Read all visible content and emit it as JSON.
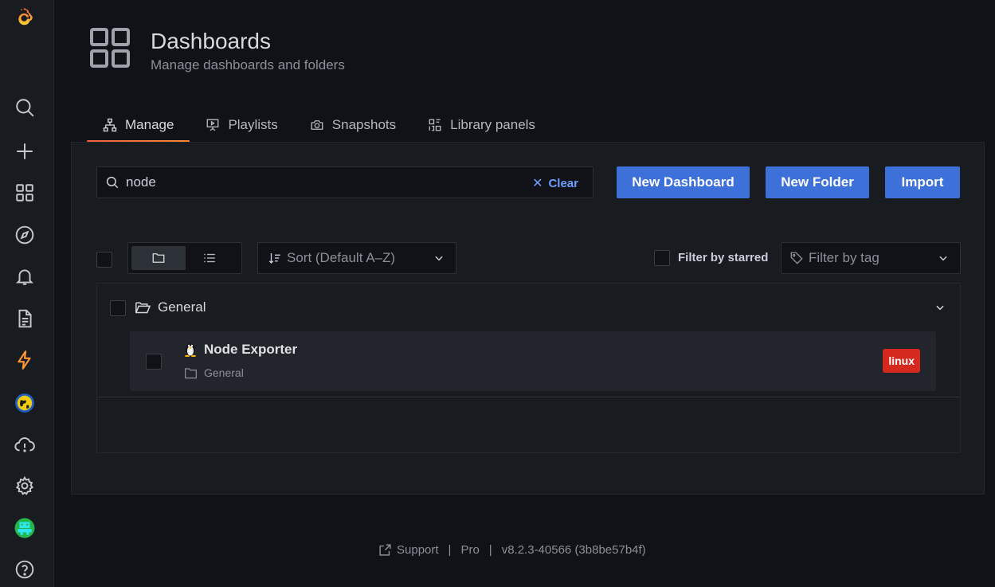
{
  "sidebar": {
    "items": [
      {
        "name": "grafana-logo-icon"
      },
      {
        "name": "search-icon"
      },
      {
        "name": "plus-icon"
      },
      {
        "name": "dashboards-icon"
      },
      {
        "name": "explore-compass-icon"
      },
      {
        "name": "alerting-bell-icon"
      },
      {
        "name": "reports-document-icon"
      },
      {
        "name": "lightning-icon"
      },
      {
        "name": "worldmap-icon"
      },
      {
        "name": "cloud-alert-icon"
      },
      {
        "name": "gear-icon"
      },
      {
        "name": "user-avatar"
      },
      {
        "name": "help-icon"
      }
    ]
  },
  "header": {
    "title": "Dashboards",
    "subtitle": "Manage dashboards and folders"
  },
  "tabs": [
    {
      "label": "Manage",
      "active": true
    },
    {
      "label": "Playlists",
      "active": false
    },
    {
      "label": "Snapshots",
      "active": false
    },
    {
      "label": "Library panels",
      "active": false
    }
  ],
  "search": {
    "value": "node",
    "clear_label": "Clear"
  },
  "buttons": {
    "new_dashboard": "New Dashboard",
    "new_folder": "New Folder",
    "import": "Import"
  },
  "filters": {
    "sort_label": "Sort (Default A–Z)",
    "starred_label": "Filter by starred",
    "tag_placeholder": "Filter by tag"
  },
  "results": {
    "folder_name": "General",
    "dashboards": [
      {
        "title": "Node Exporter",
        "folder": "General",
        "tags": [
          "linux"
        ]
      }
    ]
  },
  "footer": {
    "support": "Support",
    "edition": "Pro",
    "version": "v8.2.3-40566 (3b8be57b4f)"
  },
  "colors": {
    "primary_button": "#3d71d9",
    "tab_active_underline": "#f55f3e",
    "tag_linux": "#d5291f",
    "background": "#111217",
    "panel": "#181b1f"
  }
}
